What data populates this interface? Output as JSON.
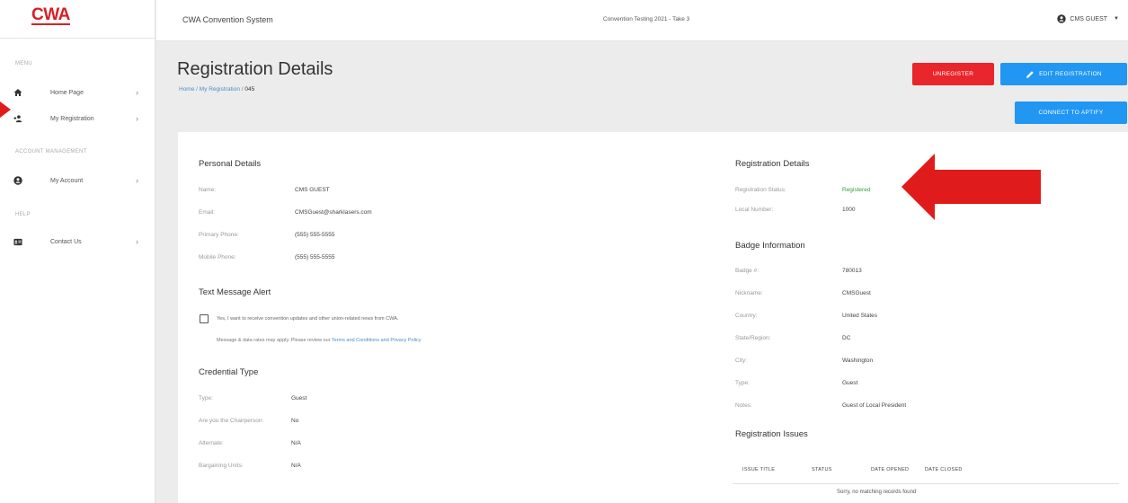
{
  "app": {
    "logo": "CWA",
    "title": "CWA Convention System",
    "convention": "Convention Testing 2021 - Take 3",
    "user": "CMS GUEST"
  },
  "sidebar": {
    "sections": [
      "MENU",
      "ACCOUNT MANAGEMENT",
      "HELP"
    ],
    "items": [
      {
        "label": "Home Page",
        "icon": "home-icon"
      },
      {
        "label": "My Registration",
        "icon": "user-plus-icon"
      },
      {
        "label": "My Account",
        "icon": "account-circle-icon"
      },
      {
        "label": "Contact Us",
        "icon": "contact-card-icon"
      }
    ]
  },
  "page": {
    "title": "Registration Details",
    "breadcrumb": {
      "home": "Home",
      "sep": "/",
      "parent": "My Registration",
      "current": "045"
    }
  },
  "actions": {
    "unregister": "UNREGISTER",
    "edit": "EDIT REGISTRATION",
    "connect": "CONNECT TO APTIFY"
  },
  "personal": {
    "title": "Personal Details",
    "fields": [
      {
        "label": "Name:",
        "value": "CMS GUEST"
      },
      {
        "label": "Email:",
        "value": "CMSGuest@sharklasers.com"
      },
      {
        "label": "Primary Phone:",
        "value": "(555) 555-5555"
      },
      {
        "label": "Mobile Phone:",
        "value": "(555) 555-5555"
      }
    ]
  },
  "text_alert": {
    "title": "Text Message Alert",
    "checkbox_label": "Yes, I want to receive convention updates and other union-related news from CWA.",
    "note_prefix": "Message & data rates may apply. Please review our",
    "note_link": "Terms and Conditions and Privacy Policy"
  },
  "credential": {
    "title": "Credential Type",
    "fields": [
      {
        "label": "Type:",
        "value": "Guest"
      },
      {
        "label": "Are you the Chairperson:",
        "value": "No"
      },
      {
        "label": "Alternate:",
        "value": "N/A"
      },
      {
        "label": "Bargaining Units:",
        "value": "N/A"
      }
    ]
  },
  "registration": {
    "title": "Registration Details",
    "fields": [
      {
        "label": "Registration Status:",
        "value": "Registered"
      },
      {
        "label": "Local Number:",
        "value": "1000"
      }
    ]
  },
  "badge": {
    "title": "Badge Information",
    "fields": [
      {
        "label": "Badge #:",
        "value": "780013"
      },
      {
        "label": "Nickname:",
        "value": "CMSGuest"
      },
      {
        "label": "Country:",
        "value": "United States"
      },
      {
        "label": "State/Region:",
        "value": "DC"
      },
      {
        "label": "City:",
        "value": "Washington"
      },
      {
        "label": "Type:",
        "value": "Guest"
      },
      {
        "label": "Notes:",
        "value": "Guest of Local President"
      }
    ]
  },
  "issues": {
    "title": "Registration Issues",
    "columns": [
      "ISSUE TITLE",
      "STATUS",
      "DATE OPENED",
      "DATE CLOSED"
    ],
    "empty": "Sorry, no matching records found"
  },
  "colors": {
    "brand_red": "#d62027",
    "button_blue": "#2196f3",
    "status_green": "#3c9a3c",
    "arrow_red": "#e01b1b"
  }
}
